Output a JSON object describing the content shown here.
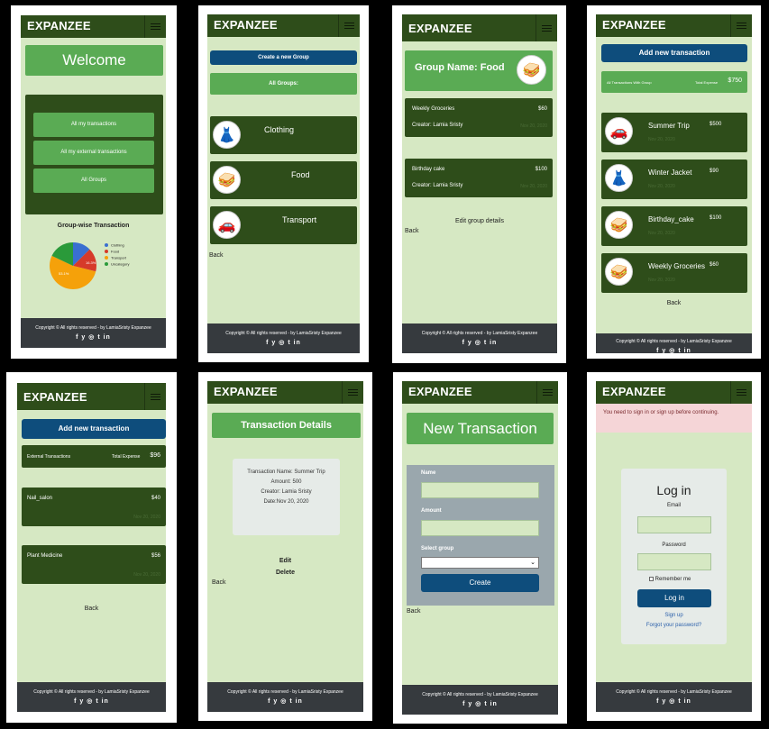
{
  "brand": "EXPANZEE",
  "footer": {
    "copy": "Copyright © All rights reserved - by LamiaSristy Expanzee",
    "social": "f y ◎ t in"
  },
  "back": "Back",
  "s1": {
    "welcome": "Welcome",
    "menu": [
      "All my transactions",
      "All my external transactions",
      "All Groups"
    ],
    "chart_title": "Group-wise Transaction",
    "chart_data": {
      "type": "pie",
      "categories": [
        "Clothing",
        "Food",
        "Transport",
        "Uncategory"
      ],
      "values": [
        12.6,
        16.3,
        53.1,
        18.0
      ],
      "colors": [
        "#3a6fd0",
        "#d63a2a",
        "#f5a10a",
        "#2a9a3a"
      ],
      "labels": [
        "16.3%",
        "53.1%"
      ]
    }
  },
  "s2": {
    "create": "Create a new Group",
    "all_groups": "All Groups:",
    "groups": [
      "Clothing",
      "Food",
      "Transport"
    ]
  },
  "s3": {
    "title": "Group Name: Food",
    "items": [
      {
        "name": "Weekly Groceries",
        "amount": "$60",
        "creator": "Creator: Lamia Sristy",
        "date": "Nov 20, 2020"
      },
      {
        "name": "Birthday  cake",
        "amount": "$100",
        "creator": "Creator: Lamia Sristy",
        "date": "Nov 20, 2020"
      }
    ],
    "edit": "Edit group details"
  },
  "s4": {
    "add": "Add new transaction",
    "label": "All Transactions With Group",
    "total_label": "Total Expense",
    "total": "$750",
    "items": [
      {
        "name": "Summer Trip",
        "amount": "$500",
        "date": "Nov 20, 2020"
      },
      {
        "name": "Winter Jacket",
        "amount": "$90",
        "date": "Nov 20, 2020"
      },
      {
        "name": "Birthday_cake",
        "amount": "$100",
        "date": "Nov 20, 2020"
      },
      {
        "name": "Weekly Groceries",
        "amount": "$60",
        "date": "Nov 20, 2020"
      }
    ]
  },
  "s5": {
    "add": "Add new transaction",
    "label": "External Transactions",
    "total_label": "Total Expense",
    "total": "$96",
    "items": [
      {
        "name": "Nail_salon",
        "amount": "$40",
        "date": "Nov 20, 2020"
      },
      {
        "name": "Plant Medicine",
        "amount": "$56",
        "date": "Nov 20, 2020"
      }
    ]
  },
  "s6": {
    "title": "Transaction Details",
    "name": "Transaction Name: Summer Trip",
    "amount": "Amount: 500",
    "creator": "Creator: Lamia Sristy",
    "date": "Date:Nov 20, 2020",
    "edit": "Edit",
    "delete": "Delete"
  },
  "s7": {
    "title": "New Transaction",
    "name": "Name",
    "amount": "Amount",
    "group": "Select group",
    "create": "Create"
  },
  "s8": {
    "alert": "You need to sign in or sign up before continuing.",
    "title": "Log in",
    "email": "Email",
    "password": "Password",
    "remember": "Remember me",
    "login": "Log in",
    "signup": "Sign up",
    "forgot": "Forgot your password?"
  }
}
